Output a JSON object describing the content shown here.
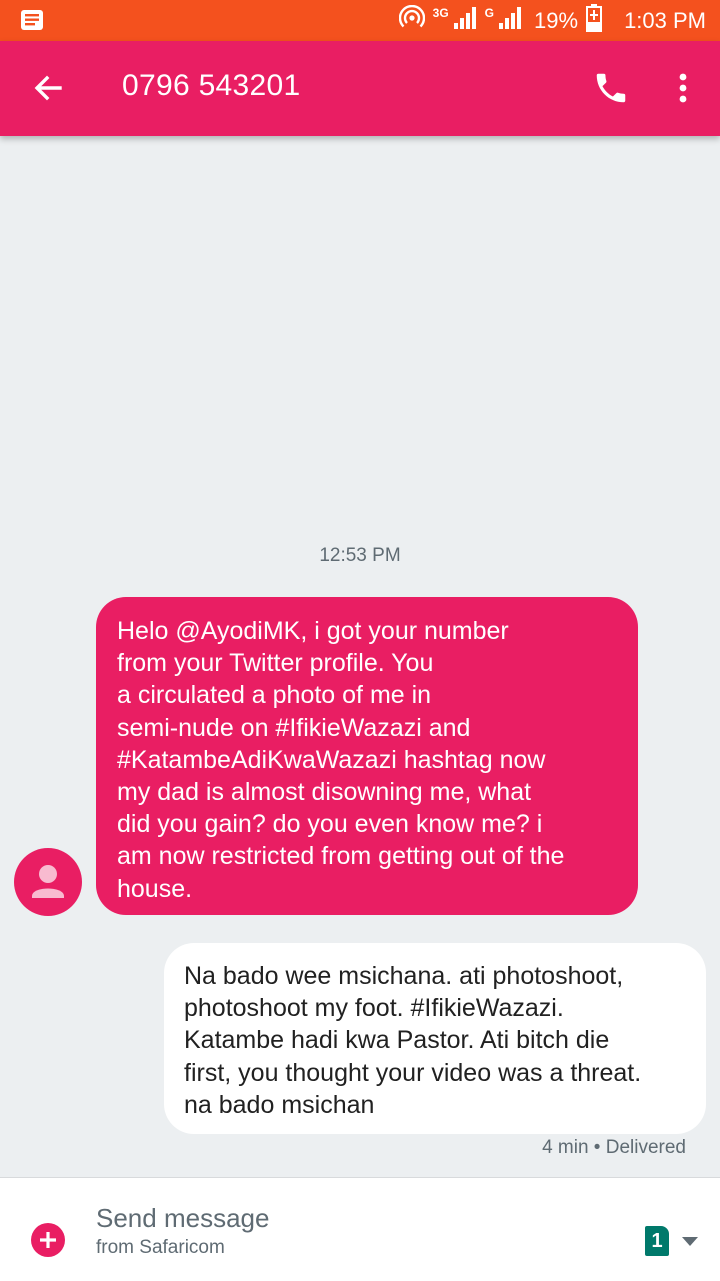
{
  "status_bar": {
    "network_3g": "3G",
    "network_g": "G",
    "battery": "19%",
    "time": "1:03 PM"
  },
  "app_bar": {
    "title": "0796 543201"
  },
  "conversation": {
    "timestamp": "12:53 PM",
    "incoming": {
      "lines": [
        "Helo @AyodiMK, i got your number",
        "from your Twitter profile. You",
        "a circulated a photo of me in",
        "semi-nude on #IfikieWazazi and",
        "#KatambeAdiKwaWazazi hashtag now",
        "my dad is almost disowning me, what",
        "did you gain? do you even know me? i",
        "am now restricted from getting out of the",
        "house."
      ]
    },
    "outgoing": {
      "lines": [
        "Na bado wee msichana. ati photoshoot,",
        "photoshoot my foot. #IfikieWazazi.",
        "Katambe hadi kwa Pastor. Ati bitch die",
        "first, you thought your video was a threat.",
        "na bado msichan"
      ],
      "meta": "4 min • Delivered"
    }
  },
  "compose": {
    "placeholder": "Send message",
    "subline": "from Safaricom",
    "sim_slot": "1"
  },
  "colors": {
    "status_bar": "#f4511e",
    "app_bar": "#e91e63",
    "incoming_bubble": "#e91e63",
    "outgoing_bubble": "#ffffff",
    "background": "#eceff1",
    "sim_badge": "#00796b"
  }
}
